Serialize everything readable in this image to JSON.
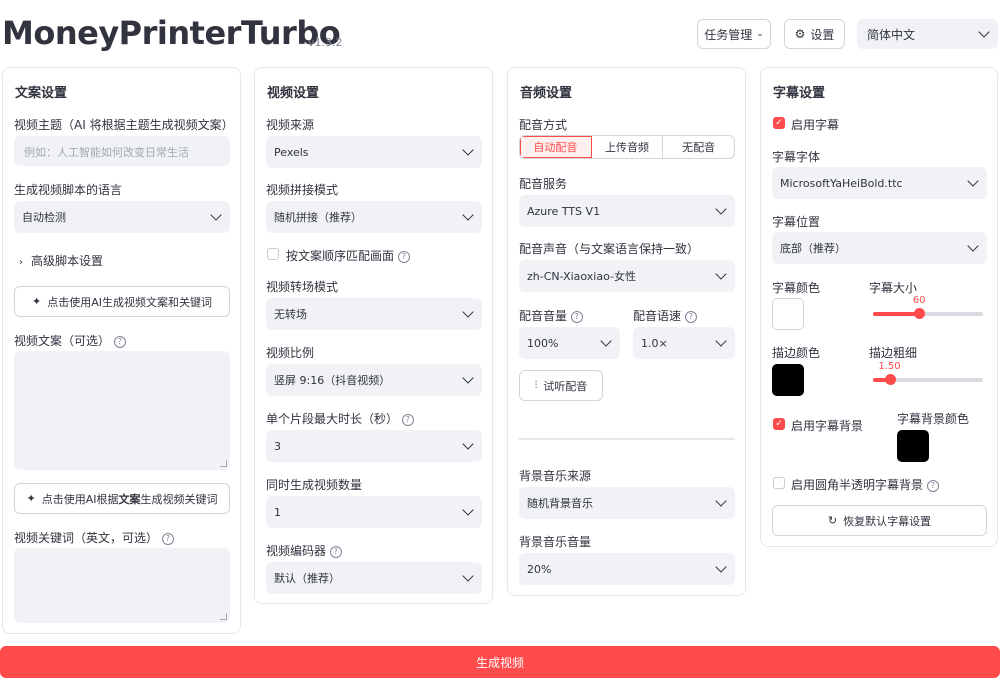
{
  "header": {
    "title": "MoneyPrinterTurbo",
    "version": "v1.3.2",
    "task_mgmt_label": "任务管理",
    "settings_label": "设置",
    "language_value": "简体中文"
  },
  "script_panel": {
    "title": "文案设置",
    "topic_label": "视频主题（AI 将根据主题生成视频文案）",
    "topic_placeholder": "例如：人工智能如何改变日常生活",
    "lang_label": "生成视频脚本的语言",
    "lang_value": "自动检测",
    "advanced_label": "高级脚本设置",
    "gen_script_button": "点击使用AI生成视频文案和关键词",
    "script_label": "视频文案（可选）",
    "gen_keywords_button_pre": "点击使用AI根据",
    "gen_keywords_button_bold": "文案",
    "gen_keywords_button_post": "生成视频关键词",
    "keywords_label": "视频关键词（英文，可选）"
  },
  "video_panel": {
    "title": "视频设置",
    "source_label": "视频来源",
    "source_value": "Pexels",
    "concat_label": "视频拼接模式",
    "concat_value": "随机拼接（推荐）",
    "match_checkbox_label": "按文案顺序匹配画面",
    "transition_label": "视频转场模式",
    "transition_value": "无转场",
    "ratio_label": "视频比例",
    "ratio_value": "竖屏 9:16（抖音视频）",
    "clip_duration_label": "单个片段最大时长（秒）",
    "clip_duration_value": "3",
    "count_label": "同时生成视频数量",
    "count_value": "1",
    "encoder_label": "视频编码器",
    "encoder_value": "默认（推荐）"
  },
  "audio_panel": {
    "title": "音频设置",
    "dub_mode_label": "配音方式",
    "dub_modes": [
      "自动配音",
      "上传音频",
      "无配音"
    ],
    "dub_service_label": "配音服务",
    "dub_service_value": "Azure TTS V1",
    "voice_label": "配音声音（与文案语言保持一致）",
    "voice_value": "zh-CN-Xiaoxiao-女性",
    "volume_label": "配音音量",
    "volume_value": "100%",
    "speed_label": "配音语速",
    "speed_value": "1.0×",
    "preview_button": "试听配音",
    "bgm_source_label": "背景音乐来源",
    "bgm_source_value": "随机背景音乐",
    "bgm_volume_label": "背景音乐音量",
    "bgm_volume_value": "20%"
  },
  "subtitle_panel": {
    "title": "字幕设置",
    "enable_label": "启用字幕",
    "font_label": "字幕字体",
    "font_value": "MicrosoftYaHeiBold.ttc",
    "position_label": "字幕位置",
    "position_value": "底部（推荐）",
    "color_label": "字幕颜色",
    "color_value": "#FFFFFF",
    "size_label": "字幕大小",
    "size_value": "60",
    "size_fraction": 0.42,
    "stroke_color_label": "描边颜色",
    "stroke_color_value": "#000000",
    "stroke_width_label": "描边粗细",
    "stroke_width_value": "1.50",
    "stroke_width_fraction": 0.15,
    "bg_enable_label": "启用字幕背景",
    "bg_color_label": "字幕背景颜色",
    "bg_color_value": "#000000",
    "rounded_bg_label": "启用圆角半透明字幕背景",
    "reset_button": "恢复默认字幕设置"
  },
  "footer": {
    "generate_button": "生成视频"
  },
  "colors": {
    "accent": "#ff4b4b",
    "input_bg": "#f0f2f6"
  }
}
